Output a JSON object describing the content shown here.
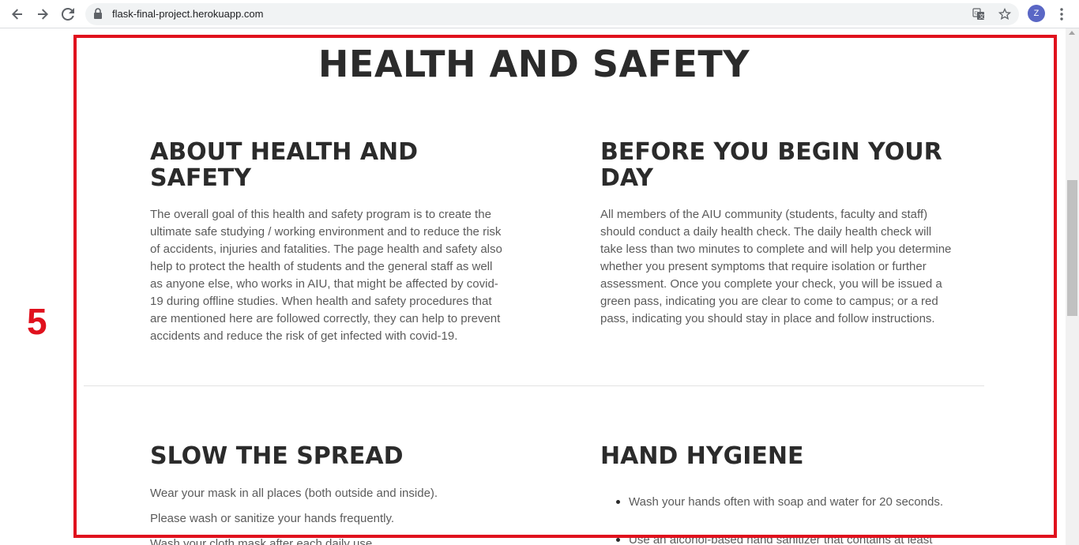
{
  "browser": {
    "url": "flask-final-project.herokuapp.com",
    "profile_initial": "Z"
  },
  "annotation": {
    "step_number": "5",
    "highlight_color": "#e0111d"
  },
  "page": {
    "title": "HEALTH AND SAFETY",
    "sections": [
      {
        "heading_line1": "ABOUT HEALTH AND",
        "heading_line2": "SAFETY",
        "body_lines": [
          "The overall goal of this health and safety program is to create the",
          "ultimate safe studying / working environment and to reduce the risk",
          "of accidents, injuries and fatalities. The page health and safety also",
          "help to protect the health of students and the general staff as well",
          "as anyone else, who works in AIU, that might be affected by covid-",
          "19 during offline studies. When health and safety procedures that",
          "are mentioned here are followed correctly, they can help to prevent",
          "accidents and reduce the risk of get infected with covid-19."
        ]
      },
      {
        "heading_line1": "BEFORE YOU BEGIN YOUR",
        "heading_line2": "DAY",
        "body_lines": [
          "All members of the AIU community (students, faculty and staff)",
          "should conduct a daily health check. The daily health check will",
          "take less than two minutes to complete and will help you determine",
          "whether you present symptoms that require isolation or further",
          "assessment. Once you complete your check, you will be issued a",
          "green pass, indicating you are clear to come to campus; or a red",
          "pass, indicating you should stay in place and follow instructions."
        ]
      },
      {
        "heading": "SLOW THE SPREAD",
        "paragraphs": [
          "Wear your mask in all places (both outside and inside).",
          "Please wash or sanitize your hands frequently.",
          "Wash your cloth mask after each daily use."
        ]
      },
      {
        "heading": "HAND HYGIENE",
        "bullets": [
          "Wash your hands often with soap and water for 20 seconds.",
          "Use an alcohol-based hand sanitizer that contains at least"
        ]
      }
    ]
  }
}
